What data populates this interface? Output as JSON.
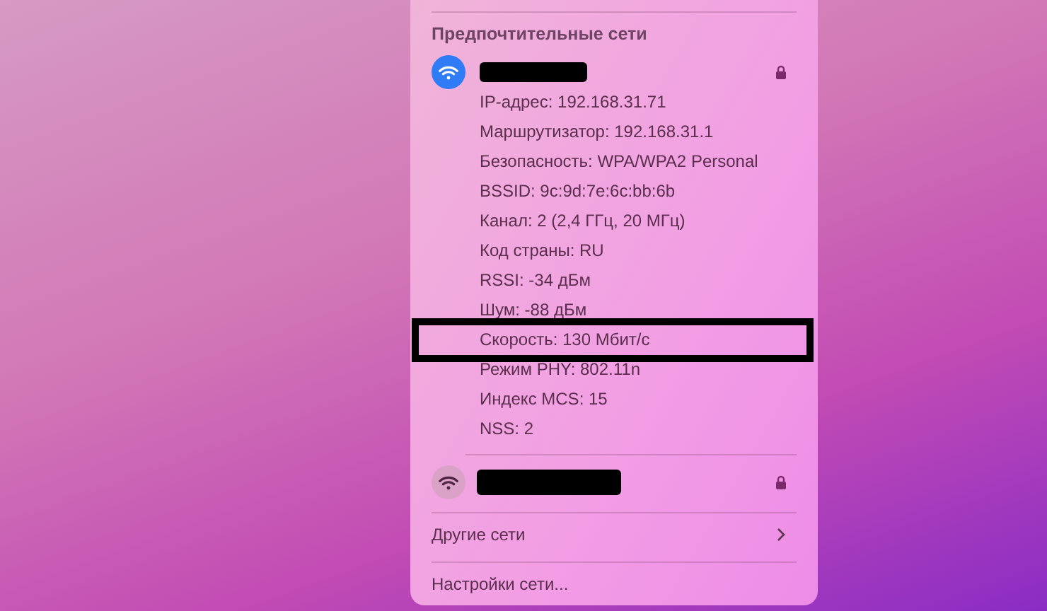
{
  "menu": {
    "section_heading": "Предпочтительные сети",
    "networks": [
      {
        "selected": true,
        "locked": true,
        "details": [
          {
            "text": "IP-адрес: 192.168.31.71",
            "highlighted": false
          },
          {
            "text": "Маршрутизатор: 192.168.31.1",
            "highlighted": false
          },
          {
            "text": "Безопасность: WPA/WPA2 Personal",
            "highlighted": false
          },
          {
            "text": "BSSID: 9c:9d:7e:6c:bb:6b",
            "highlighted": false
          },
          {
            "text": "Канал: 2 (2,4 ГГц, 20 МГц)",
            "highlighted": false
          },
          {
            "text": "Код страны: RU",
            "highlighted": false
          },
          {
            "text": "RSSI: -34 дБм",
            "highlighted": false
          },
          {
            "text": "Шум: -88 дБм",
            "highlighted": false
          },
          {
            "text": "Скорость: 130 Мбит/с",
            "highlighted": true
          },
          {
            "text": "Режим PHY: 802.11n",
            "highlighted": false
          },
          {
            "text": "Индекс MCS: 15",
            "highlighted": false
          },
          {
            "text": "NSS: 2",
            "highlighted": false
          }
        ]
      },
      {
        "selected": false,
        "locked": true
      }
    ],
    "items": [
      {
        "label": "Другие сети",
        "kind": "submenu"
      },
      {
        "label": "Настройки сети...",
        "kind": "action"
      }
    ]
  }
}
